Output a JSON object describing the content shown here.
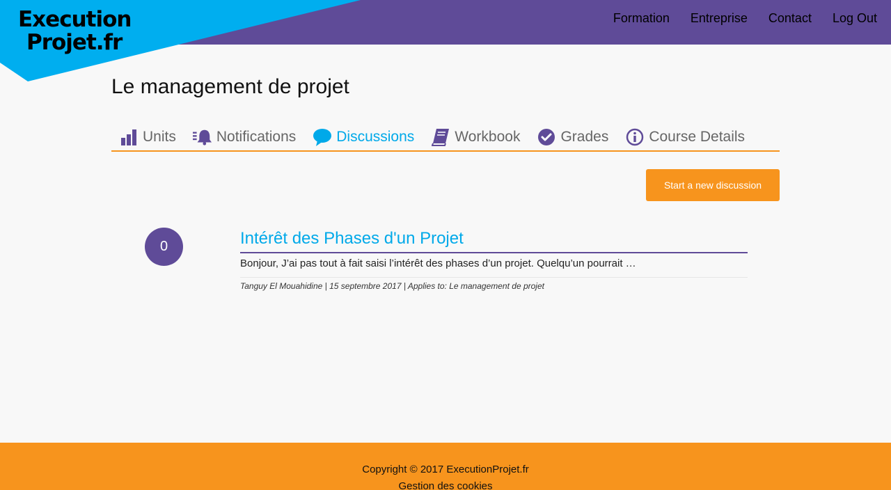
{
  "header": {
    "logo_line1": "Execution",
    "logo_line2": "Projet.fr",
    "nav": [
      "Formation",
      "Entreprise",
      "Contact",
      "Log Out"
    ]
  },
  "page": {
    "title": "Le management de projet"
  },
  "tabs": [
    {
      "label": "Units",
      "icon": "bar-chart-icon"
    },
    {
      "label": "Notifications",
      "icon": "bell-icon"
    },
    {
      "label": "Discussions",
      "icon": "speech-bubble-icon",
      "active": true
    },
    {
      "label": "Workbook",
      "icon": "book-icon"
    },
    {
      "label": "Grades",
      "icon": "check-circle-icon"
    },
    {
      "label": "Course Details",
      "icon": "info-icon"
    }
  ],
  "actions": {
    "new_discussion": "Start a new discussion"
  },
  "discussion": {
    "count": "0",
    "title": "Intérêt des Phases d'un Projet",
    "excerpt": "Bonjour, J’ai pas tout à fait saisi l’intérêt des phases d’un projet. Quelqu’un pourrait …",
    "meta": "Tanguy El Mouahidine | 15 septembre 2017 | Applies to: Le management de projet"
  },
  "footer": {
    "copyright": "Copyright © 2017 ExecutionProjet.fr",
    "cookies": "Gestion des cookies"
  },
  "colors": {
    "purple": "#5f4b98",
    "blue": "#00a9e9",
    "orange": "#f7941d"
  }
}
